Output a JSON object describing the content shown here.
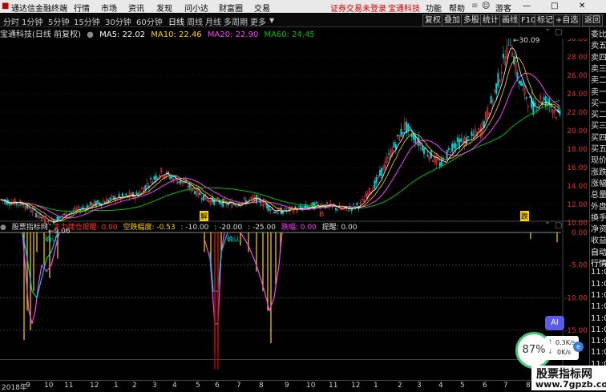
{
  "menubar": {
    "logo_text": "通达信金融终端",
    "items": [
      "行情",
      "市场",
      "资讯",
      "发现",
      "问小达",
      "财富圈",
      "交易"
    ],
    "login_warning": "证券交易未登录",
    "stock_link": "宝通科技",
    "right_items": [
      "功能",
      "帮助",
      "游客"
    ],
    "window_buttons": [
      "—",
      "□",
      "✕"
    ]
  },
  "periodbar": {
    "periods": [
      "分时",
      "1分钟",
      "5分钟",
      "15分钟",
      "30分钟",
      "60分钟",
      "日线",
      "周线",
      "月线",
      "多周期",
      "更多"
    ],
    "active": "日线",
    "tools": [
      "复权",
      "叠加",
      "多股",
      "统计",
      "画线",
      "F10",
      "标记",
      "+自选",
      "返回"
    ]
  },
  "maline": {
    "title": "宝通科技(日线 前复权)",
    "ma5": "MA5: 22.02",
    "ma10": "MA10: 22.46",
    "ma20": "MA20: 22.90",
    "ma60": "MA60: 24.45"
  },
  "price_chart": {
    "y_ticks": [
      "30.00",
      "28.00",
      "26.00",
      "24.00",
      "22.00",
      "20.00",
      "18.00",
      "16.00",
      "14.00",
      "12.00",
      "10.00"
    ],
    "high_label": "30.09",
    "low_label": "9.06",
    "markers": [
      {
        "text": "解"
      },
      {
        "text": "B"
      },
      {
        "text": "跌"
      }
    ],
    "colors": {
      "up": "#ff3b3b",
      "down": "#00d0d0",
      "ma5": "#ffffff",
      "ma10": "#ffd400",
      "ma20": "#ff40ff",
      "ma60": "#00c000"
    }
  },
  "indicator": {
    "name": "股票指标网",
    "f1": "主力建仓提醒: 0.00",
    "f2": "空跌幅度: -0.53",
    "f3": ": -10.00",
    "f4": ": -20.00",
    "f5": ": -25.00",
    "f6": "跌幅: 0.00",
    "f7": "提醒: 0.00",
    "y_ticks": [
      "0.00",
      "-5.00",
      "-10.00",
      "-15.00"
    ],
    "labels": [
      "确认",
      "确认"
    ]
  },
  "dates": [
    "2018年",
    "9",
    "10",
    "11",
    "12",
    "1",
    "2",
    "3",
    "4",
    "5",
    "6",
    "7",
    "8",
    "9",
    "10",
    "11",
    "12",
    "1",
    "2",
    "3",
    "4",
    "5",
    "6",
    "7",
    "8",
    "9"
  ],
  "right_panel": [
    "委比",
    "卖五",
    "卖四",
    "卖三",
    "卖二",
    "卖一",
    "买一",
    "买二",
    "买三",
    "买四",
    "买五",
    "现价",
    "涨跌",
    "涨幅",
    "总量",
    "外盘",
    "换手",
    "净资",
    "收益",
    "自动",
    "行情",
    "11:0",
    "11:0",
    "11:0",
    "11:0",
    "11:0",
    "11:0",
    "11:0",
    "11:0",
    "11:0",
    "11:0"
  ],
  "widgets": {
    "ai": "AI",
    "gauge": "87%",
    "up_speed": "0.3K/s",
    "down_speed": "0K/s",
    "watermark_cn": "股票指标网",
    "watermark_url": "www.7gpzb.com"
  }
}
